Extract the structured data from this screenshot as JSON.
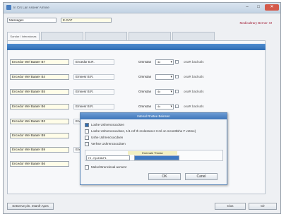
{
  "window": {
    "title": "In Crs Lan Asseer Amnse",
    "controls": {
      "minimize": "–",
      "maximize": "□",
      "close": "✕"
    }
  },
  "header": {
    "name_label": "Messages",
    "name_value": "E-GAT",
    "right_text": "Medicaltrary Berner: M"
  },
  "tabs": [
    {
      "label": "Sandar / Intenatonas"
    },
    {
      "label": ""
    },
    {
      "label": ""
    },
    {
      "label": ""
    },
    {
      "label": ""
    }
  ],
  "rows": [
    {
      "input": "Encedor Wel Baater B7",
      "ro": "Encedor B.R.",
      "lbl": "Omnstan",
      "sel": "4c",
      "trail": "onaR backutls"
    },
    {
      "input": "Encedor Wel Baater B4",
      "ro": "Emnesr B.R.",
      "lbl": "Omnstan",
      "sel": "",
      "trail": "onaR backutls"
    },
    {
      "input": "Encedor Wel Baater B5",
      "ro": "Emnesr B.R.",
      "lbl": "Omnstan",
      "sel": "4c",
      "trail": "onaR backutls"
    },
    {
      "input": "Encedor Wel Baater B6",
      "ro": "Emnesr B.R.",
      "lbl": "Omnstan",
      "sel": "4c",
      "trail": "onaR backutls"
    },
    {
      "input": "Encedor Wel Baater B3",
      "ro": "Encmsr B.R.",
      "lbl": "",
      "sel": "",
      "trail": ""
    },
    {
      "input": "Encedor Wel Baater B9",
      "ro": "",
      "lbl": "",
      "sel": "",
      "trail": ""
    },
    {
      "input": "Encedor Wel Baater B9",
      "ro": "Encmsr B.R.",
      "lbl": "",
      "sel": "",
      "trail": ""
    },
    {
      "input": "Encedor Wel Baater B6",
      "ro": "",
      "lbl": "",
      "sel": "",
      "trail": ""
    }
  ],
  "bottom": {
    "left_button": "Setserve pln. mtanfr Apes",
    "ok_button": "Clos",
    "cancel_button": "Clr"
  },
  "dialog": {
    "title": "Intenal Rnstee Beinsen",
    "options": [
      {
        "label": "Loshe Ushrencsocdsen",
        "checked": true
      },
      {
        "label": "Loshe Ushrencsocdsen, 1/1 ref th reslestoscr 3-ml on mcsnttlshe F vntme)",
        "checked": false
      },
      {
        "label": "Ushe Ushrencsocdsen",
        "checked": false
      },
      {
        "label": "Verhse Ushrencsocdsen",
        "checked": false
      }
    ],
    "subpanel_header": "Enemale Threan",
    "select_left": "Hl - Hpdt 8cF1",
    "select_right": "",
    "note_checkbox": "Melsd Brenclesal acmenr",
    "ok_button": "OK",
    "cancel_button": "Canel"
  }
}
